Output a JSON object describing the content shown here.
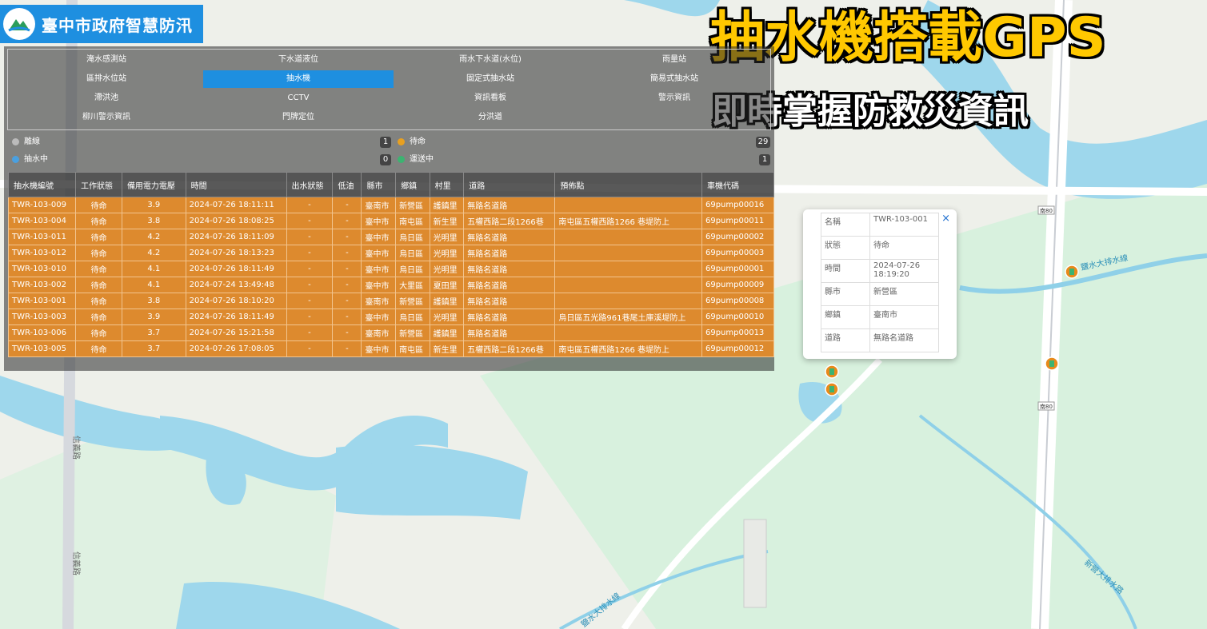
{
  "brand": {
    "title": "臺中市政府智慧防汛"
  },
  "headline": {
    "line1": "抽水機搭載GPS",
    "line2": "即時掌握防救災資訊"
  },
  "layers": [
    {
      "label": "淹水感測站"
    },
    {
      "label": "下水道液位"
    },
    {
      "label": "雨水下水道(水位)"
    },
    {
      "label": "雨量站"
    },
    {
      "label": "區排水位站"
    },
    {
      "label": "抽水機"
    },
    {
      "label": "固定式抽水站"
    },
    {
      "label": "簡易式抽水站"
    },
    {
      "label": "滯洪池"
    },
    {
      "label": "CCTV"
    },
    {
      "label": "資訊看板"
    },
    {
      "label": "警示資訊"
    },
    {
      "label": "柳川警示資訊"
    },
    {
      "label": "門牌定位"
    },
    {
      "label": "分洪道"
    }
  ],
  "active_layer": "抽水機",
  "status": {
    "offline": {
      "label": "離線",
      "count": "1"
    },
    "standby": {
      "label": "待命",
      "count": "29"
    },
    "pumping": {
      "label": "抽水中",
      "count": "0"
    },
    "moving": {
      "label": "運送中",
      "count": "1"
    }
  },
  "table": {
    "headers": [
      "抽水機編號",
      "工作狀態",
      "備用電力電壓",
      "時間",
      "出水狀態",
      "低油",
      "縣市",
      "鄉鎮",
      "村里",
      "道路",
      "預佈點",
      "車機代碼"
    ],
    "rows": [
      [
        "TWR-103-009",
        "待命",
        "3.9",
        "2024-07-26 18:11:11",
        "-",
        "-",
        "臺南市",
        "新營區",
        "護鎮里",
        "無路名道路",
        "",
        "69pump00016"
      ],
      [
        "TWR-103-004",
        "待命",
        "3.8",
        "2024-07-26 18:08:25",
        "-",
        "-",
        "臺中市",
        "南屯區",
        "新生里",
        "五權西路二段1266巷",
        "南屯區五權西路1266 巷堤防上",
        "69pump00011"
      ],
      [
        "TWR-103-011",
        "待命",
        "4.2",
        "2024-07-26 18:11:09",
        "-",
        "-",
        "臺中市",
        "烏日區",
        "光明里",
        "無路名道路",
        "",
        "69pump00002"
      ],
      [
        "TWR-103-012",
        "待命",
        "4.2",
        "2024-07-26 18:13:23",
        "-",
        "-",
        "臺中市",
        "烏日區",
        "光明里",
        "無路名道路",
        "",
        "69pump00003"
      ],
      [
        "TWR-103-010",
        "待命",
        "4.1",
        "2024-07-26 18:11:49",
        "-",
        "-",
        "臺中市",
        "烏日區",
        "光明里",
        "無路名道路",
        "",
        "69pump00001"
      ],
      [
        "TWR-103-002",
        "待命",
        "4.1",
        "2024-07-24 13:49:48",
        "-",
        "-",
        "臺中市",
        "大里區",
        "夏田里",
        "無路名道路",
        "",
        "69pump00009"
      ],
      [
        "TWR-103-001",
        "待命",
        "3.8",
        "2024-07-26 18:10:20",
        "-",
        "-",
        "臺南市",
        "新營區",
        "護鎮里",
        "無路名道路",
        "",
        "69pump00008"
      ],
      [
        "TWR-103-003",
        "待命",
        "3.9",
        "2024-07-26 18:11:49",
        "-",
        "-",
        "臺中市",
        "烏日區",
        "光明里",
        "無路名道路",
        "烏日區五光路961巷尾土庫溪堤防上",
        "69pump00010"
      ],
      [
        "TWR-103-006",
        "待命",
        "3.7",
        "2024-07-26 15:21:58",
        "-",
        "-",
        "臺南市",
        "新營區",
        "護鎮里",
        "無路名道路",
        "",
        "69pump00013"
      ],
      [
        "TWR-103-005",
        "待命",
        "3.7",
        "2024-07-26 17:08:05",
        "-",
        "-",
        "臺中市",
        "南屯區",
        "新生里",
        "五權西路二段1266巷",
        "南屯區五權西路1266 巷堤防上",
        "69pump00012"
      ]
    ]
  },
  "popup": {
    "close": "×",
    "rows": [
      [
        "名稱",
        "TWR-103-001"
      ],
      [
        "狀態",
        "待命"
      ],
      [
        "時間",
        "2024-07-26 18:19:20"
      ],
      [
        "縣市",
        "新營區"
      ],
      [
        "鄉鎮",
        "臺南市"
      ],
      [
        "道路",
        "無路名道路"
      ]
    ]
  },
  "map_labels": {
    "road_tag_1": "南80",
    "road_tag_2": "南80",
    "drain_1": "鹽水大排水線",
    "drain_2": "新營大排水路",
    "drain_3": "鹽水大排水線",
    "road_1": "信義路",
    "road_2": "信義路"
  },
  "colors": {
    "accent": "#1e8fe0",
    "row": "#dd8a2e",
    "headline": "#ffc800"
  }
}
